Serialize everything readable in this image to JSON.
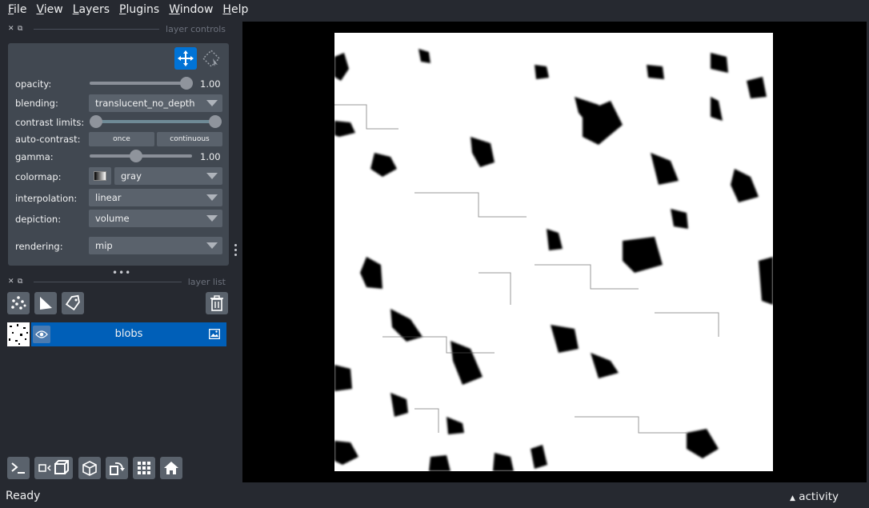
{
  "menu": [
    "File",
    "View",
    "Layers",
    "Plugins",
    "Window",
    "Help"
  ],
  "layer_controls": {
    "title": "layer controls",
    "opacity_label": "opacity:",
    "opacity_value": "1.00",
    "opacity_fraction": 1.0,
    "blending_label": "blending:",
    "blending_value": "translucent_no_depth",
    "contrast_label": "contrast limits:",
    "auto_contrast_label": "auto-contrast:",
    "once_label": "once",
    "continuous_label": "continuous",
    "gamma_label": "gamma:",
    "gamma_value": "1.00",
    "gamma_fraction": 0.5,
    "colormap_label": "colormap:",
    "colormap_value": "gray",
    "interpolation_label": "interpolation:",
    "interpolation_value": "linear",
    "depiction_label": "depiction:",
    "depiction_value": "volume",
    "rendering_label": "rendering:",
    "rendering_value": "mip"
  },
  "layer_list": {
    "title": "layer list",
    "layers": [
      {
        "name": "blobs",
        "visible": true
      }
    ]
  },
  "status": {
    "text": "Ready",
    "activity": "activity"
  },
  "colors": {
    "accent": "#005fb8",
    "move_active": "#0073d6",
    "panel": "#414851",
    "bg": "#262930"
  }
}
